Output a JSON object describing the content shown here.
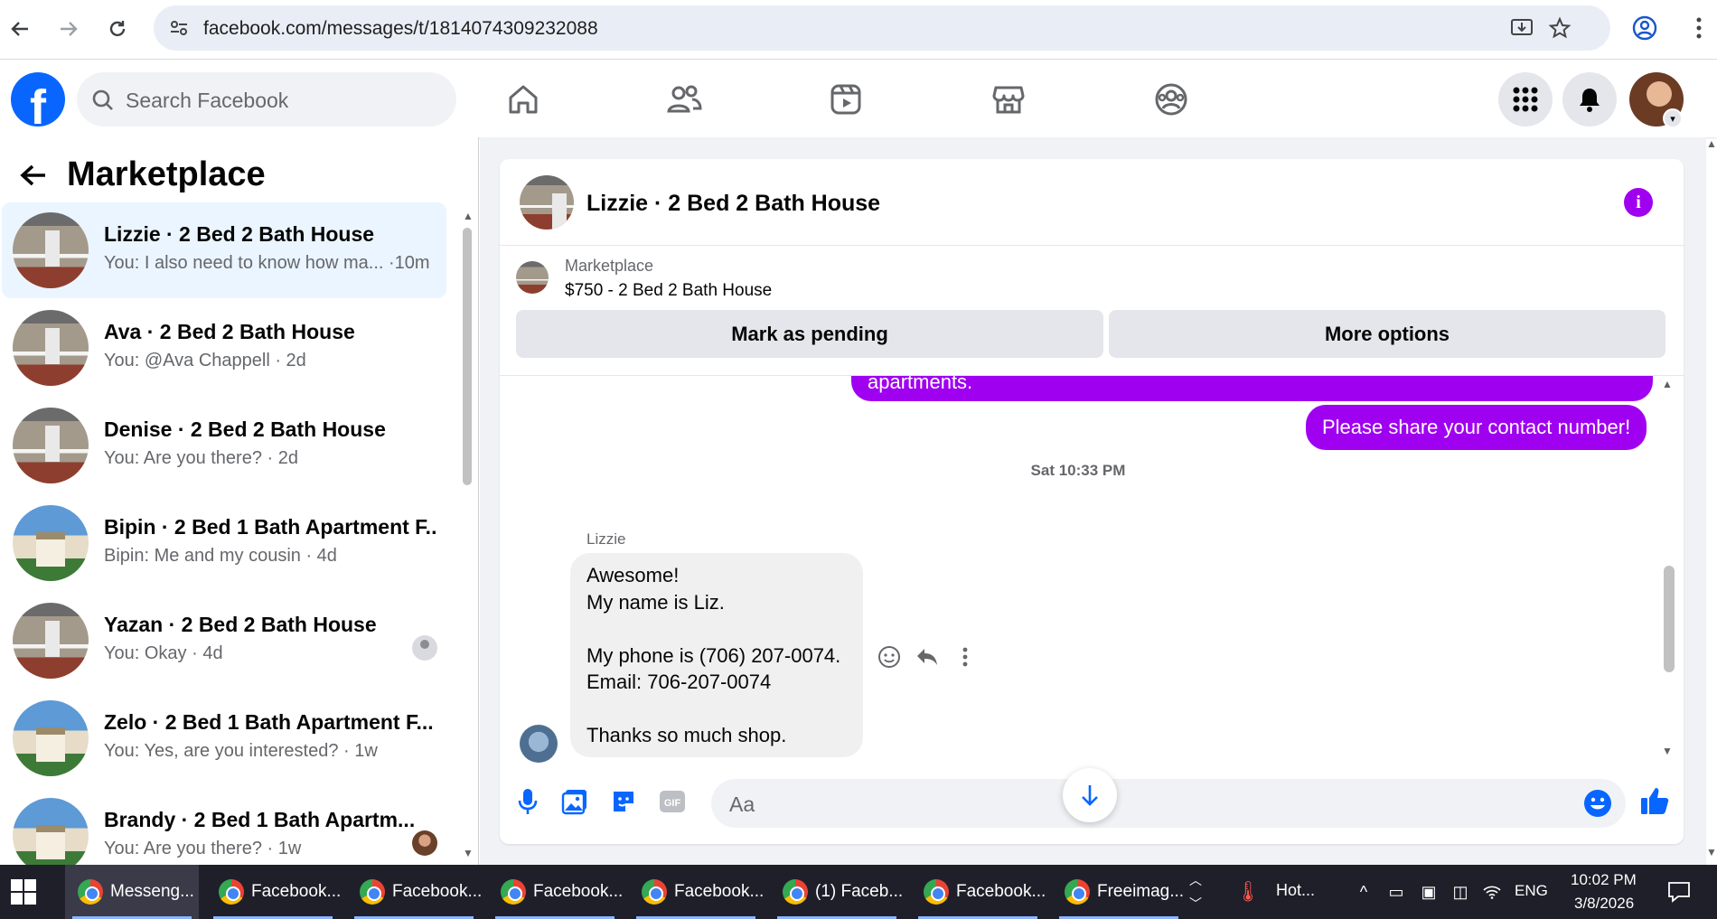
{
  "browser": {
    "url": "facebook.com/messages/t/1814074309232088"
  },
  "fb_nav": {
    "logo": "f",
    "search_placeholder": "Search Facebook"
  },
  "sidebar": {
    "title": "Marketplace",
    "conversations": [
      {
        "name": "Lizzie · 2 Bed 2 Bath House",
        "snippet": "You: I also need to know how ma... ·10m",
        "thumb": "house",
        "active": true
      },
      {
        "name": "Ava · 2 Bed 2 Bath House",
        "snippet": "You: @Ava Chappell · 2d",
        "thumb": "house"
      },
      {
        "name": "Denise · 2 Bed 2 Bath House",
        "snippet": "You: Are you there? · 2d",
        "thumb": "house"
      },
      {
        "name": "Bipin · 2 Bed 1 Bath Apartment F...",
        "snippet": "Bipin: Me and my cousin · 4d",
        "thumb": "apartment"
      },
      {
        "name": "Yazan · 2 Bed 2 Bath House",
        "snippet": "You: Okay · 4d",
        "thumb": "house",
        "badge": "seen-placeholder"
      },
      {
        "name": "Zelo · 2 Bed 1 Bath Apartment F...",
        "snippet": "You: Yes, are you interested? · 1w",
        "thumb": "apartment"
      },
      {
        "name": "Brandy · 2 Bed 1 Bath Apartm...",
        "snippet": "You: Are you there? · 1w",
        "thumb": "apartment",
        "badge": "seen-avatar"
      }
    ]
  },
  "chat": {
    "title": "Lizzie · 2 Bed 2 Bath House",
    "marketplace_label": "Marketplace",
    "listing": "$750 - 2 Bed 2 Bath House",
    "mark_pending": "Mark as pending",
    "more_options": "More options",
    "partial_message": "apartments.",
    "outgoing_message": "Please share your contact number!",
    "timestamp": "Sat 10:33 PM",
    "sender": "Lizzie",
    "incoming_lines": [
      "Awesome!",
      "My name is Liz.",
      "",
      "My phone is (706) 207-0074.",
      "Email: 706-207-0074",
      "",
      "Thanks so much shop."
    ],
    "composer_placeholder": "Aa",
    "accent_color": "#a000f0"
  },
  "taskbar": {
    "tasks": [
      "Messeng...",
      "Facebook...",
      "Facebook...",
      "Facebook...",
      "Facebook...",
      "(1) Faceb...",
      "Facebook...",
      "Freeimag..."
    ],
    "weather": "Hot...",
    "language": "ENG",
    "time": "10:02 PM",
    "date": "3/8/2026"
  }
}
